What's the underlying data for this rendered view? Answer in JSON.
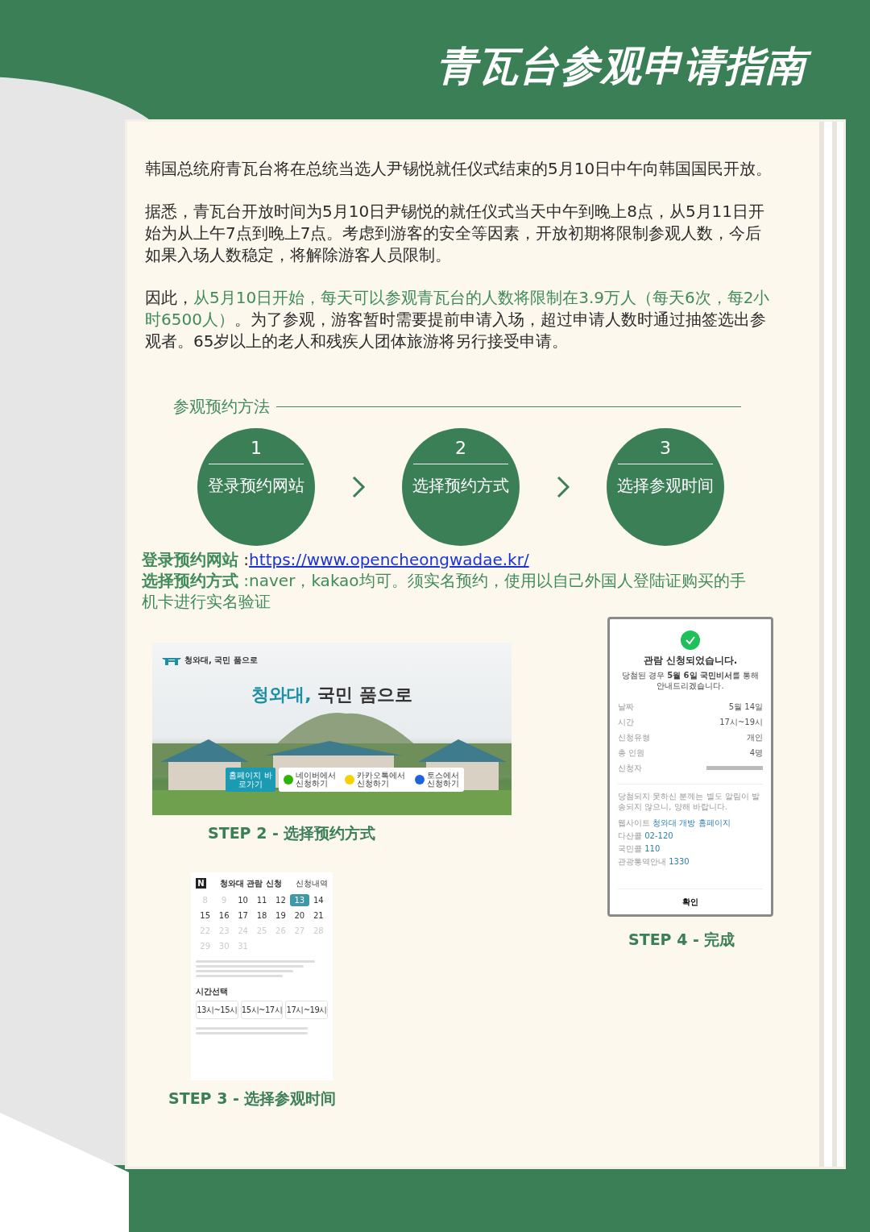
{
  "title": "青瓦台参观申请指南",
  "paragraphs": [
    {
      "segments": [
        {
          "text": "韩国总统府青瓦台将在总统当选人尹锡悦就任仪式结束的5月10日中午向韩国国民开放。",
          "highlight": false
        }
      ]
    },
    {
      "segments": [
        {
          "text": "据悉，青瓦台开放时间为5月10日尹锡悦的就任仪式当天中午到晚上8点，从5月11日开始为从上午7点到晚上7点。考虑到游客的安全等因素，开放初期将限制参观人数，今后如果入场人数稳定，将解除游客人员限制。",
          "highlight": false
        }
      ]
    },
    {
      "segments": [
        {
          "text": "因此，",
          "highlight": false
        },
        {
          "text": "从5月10日开始，每天可以参观青瓦台的人数将限制在3.9万人（每天6次，每2小时6500人）",
          "highlight": true
        },
        {
          "text": "。为了参观，游客暂时需要提前申请入场，超过申请人数时通过抽签选出参观者。65岁以上的老人和残疾人团体旅游将另行接受申请。",
          "highlight": false
        }
      ]
    }
  ],
  "section_title": "参观预约方法",
  "steps": [
    {
      "number": "1",
      "label": "登录预约网站"
    },
    {
      "number": "2",
      "label": "选择预约方式"
    },
    {
      "number": "3",
      "label": "选择参观时间"
    }
  ],
  "info_lines": [
    {
      "kind": "link",
      "label": "登录预约网站",
      "prefix": ":",
      "value": "https://www.opencheongwadae.kr/"
    },
    {
      "kind": "text",
      "label": "选择预约方式",
      "value": ":naver，kakao均可。须实名预约，使用以自己外国人登陆证购买的手机卡进行实名验证"
    }
  ],
  "website": {
    "logo_text": "청와대, 국민 품으로",
    "headline_accent": "청와대,",
    "headline": "국민 품으로",
    "home_button": "홈페이지 바로가기",
    "options": [
      {
        "kind": "naver",
        "line1": "네이버에서",
        "line2": "신청하기"
      },
      {
        "kind": "kakao",
        "line1": "카카오톡에서",
        "line2": "신청하기"
      },
      {
        "kind": "toss",
        "line1": "토스에서",
        "line2": "신청하기"
      }
    ],
    "caption": "STEP 2 - 选择预约方式"
  },
  "calendar": {
    "logo": "N",
    "title": "청와대 관람 신청",
    "history_link": "신청내역",
    "days": [
      {
        "day": "8",
        "disabled": true,
        "selected": false
      },
      {
        "day": "9",
        "disabled": true,
        "selected": false
      },
      {
        "day": "10",
        "disabled": false,
        "selected": false
      },
      {
        "day": "11",
        "disabled": false,
        "selected": false
      },
      {
        "day": "12",
        "disabled": false,
        "selected": false
      },
      {
        "day": "13",
        "disabled": false,
        "selected": true
      },
      {
        "day": "14",
        "disabled": false,
        "selected": false
      },
      {
        "day": "15",
        "disabled": false,
        "selected": false
      },
      {
        "day": "16",
        "disabled": false,
        "selected": false
      },
      {
        "day": "17",
        "disabled": false,
        "selected": false
      },
      {
        "day": "18",
        "disabled": false,
        "selected": false
      },
      {
        "day": "19",
        "disabled": false,
        "selected": false
      },
      {
        "day": "20",
        "disabled": false,
        "selected": false
      },
      {
        "day": "21",
        "disabled": false,
        "selected": false
      },
      {
        "day": "22",
        "disabled": true,
        "selected": false
      },
      {
        "day": "23",
        "disabled": true,
        "selected": false
      },
      {
        "day": "24",
        "disabled": true,
        "selected": false
      },
      {
        "day": "25",
        "disabled": true,
        "selected": false
      },
      {
        "day": "26",
        "disabled": true,
        "selected": false
      },
      {
        "day": "27",
        "disabled": true,
        "selected": false
      },
      {
        "day": "28",
        "disabled": true,
        "selected": false
      },
      {
        "day": "29",
        "disabled": true,
        "selected": false
      },
      {
        "day": "30",
        "disabled": true,
        "selected": false
      },
      {
        "day": "31",
        "disabled": true,
        "selected": false
      }
    ],
    "time_heading": "시간선택",
    "slots": [
      {
        "time": "13시~15시"
      },
      {
        "time": "15시~17시"
      },
      {
        "time": "17시~19시"
      }
    ],
    "caption": "STEP 3 - 选择参观时间"
  },
  "confirmation": {
    "title": "관람 신청되었습니다.",
    "message": "당첨된 경우 **5월 6일 국민비서**를 통해 안내드리겠습니다.",
    "rows": [
      {
        "label": "날짜",
        "value": "5월 14일"
      },
      {
        "label": "시간",
        "value": "17시~19시"
      },
      {
        "label": "신청유형",
        "value": "개인"
      },
      {
        "label": "총 인원",
        "value": "4명"
      },
      {
        "label": "신청자",
        "value": ""
      }
    ],
    "note": "당첨되지 못하신 분께는 별도 알림이 발송되지 않으니, 양해 바랍니다.",
    "contacts": [
      {
        "label": "웹사이트",
        "value": "청와대 개방 홈페이지"
      },
      {
        "label": "다산콜",
        "value": "02-120"
      },
      {
        "label": "국민콜",
        "value": "110"
      },
      {
        "label": "관광통역안내",
        "value": "1330"
      }
    ],
    "button": "확인",
    "caption": "STEP 4 - 完成"
  }
}
